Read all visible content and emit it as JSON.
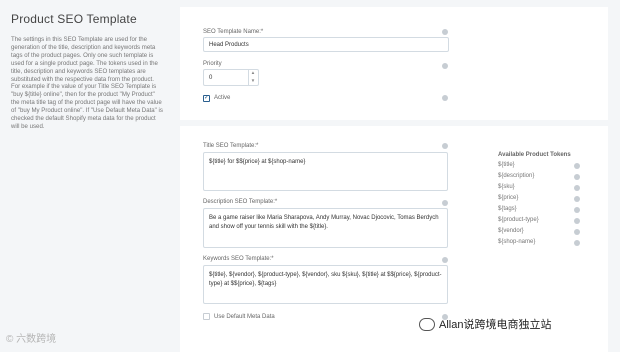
{
  "page": {
    "title": "Product SEO Template",
    "description": "The settings in this SEO Template are used for the generation of the title, description and keywords meta tags of the product pages. Only one such template is used for a single product page. The tokens used in the title, description and keywords SEO templates are substituted with the respective data from the product. For example if the value of your Title SEO Template is \"buy ${title} online\", then for the product \"My Product\" the meta title tag of the product page will have the value of \"buy My Product online\". If \"Use Default Meta Data\" is checked the default Shopify meta data for the product will be used."
  },
  "form": {
    "name_label": "SEO Template Name:*",
    "name_value": "Head Products",
    "priority_label": "Priority",
    "priority_value": "0",
    "active_label": "Active",
    "title_label": "Title SEO Template:*",
    "title_value": "${title} for $${price} at ${shop-name}",
    "description_label": "Description SEO Template:*",
    "description_value": "Be a game raiser like Maria Sharapova, Andy Murray, Novac Djocovic, Tomas Berdych and show off your tennis skill with the ${title}.",
    "keywords_label": "Keywords SEO Template:*",
    "keywords_value": "${title}, ${vendor}, ${product-type}, ${vendor}, sku ${sku}, ${title} at $${price}, ${product-type} at $${price}, ${tags}",
    "default_meta_label": "Use Default Meta Data"
  },
  "tokens": {
    "title": "Available Product Tokens",
    "items": [
      "${title}",
      "${description}",
      "${sku}",
      "${price}",
      "${tags}",
      "${product-type}",
      "${vendor}",
      "${shop-name}"
    ]
  },
  "watermarks": {
    "left": "© 六数跨境",
    "right": "Allan说跨境电商独立站"
  }
}
